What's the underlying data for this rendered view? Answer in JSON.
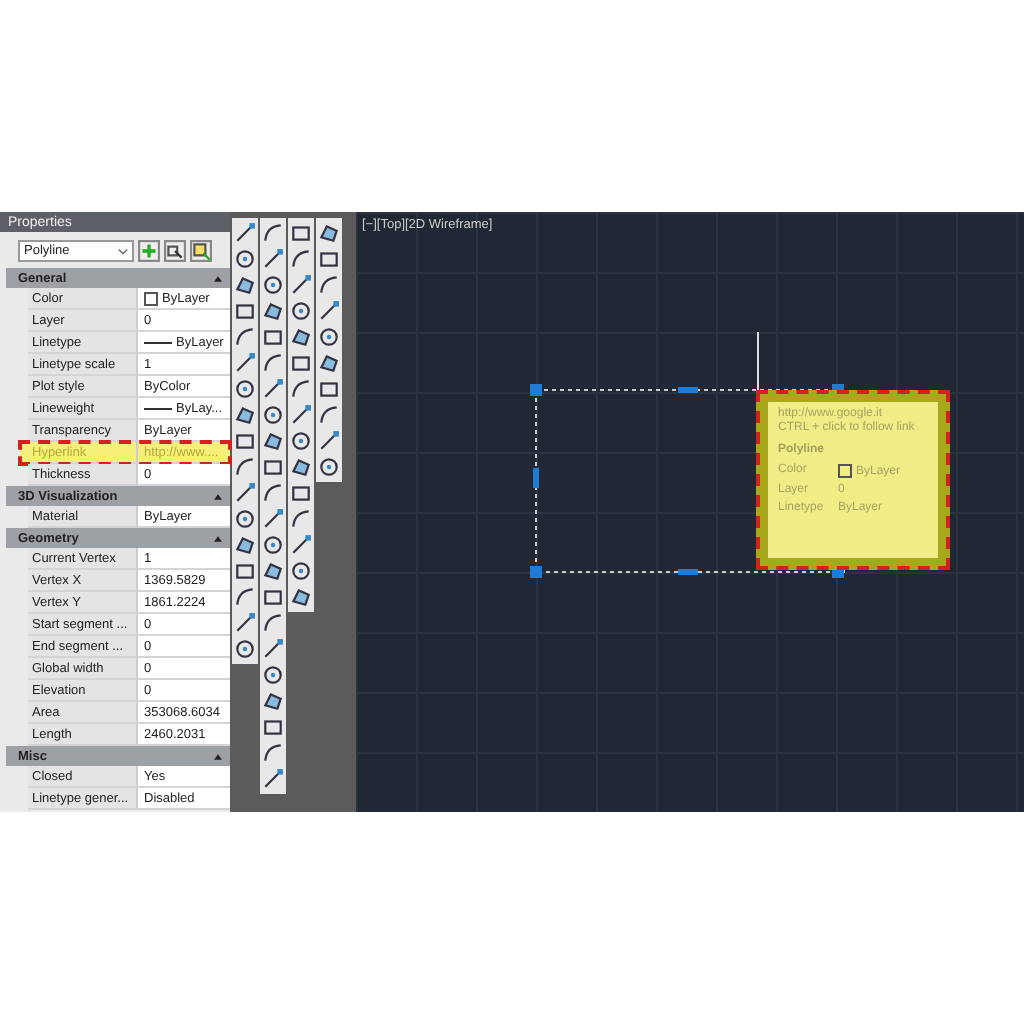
{
  "palette": {
    "title": "Properties",
    "object_type": "Polyline"
  },
  "sections": [
    {
      "title": "General",
      "expanded": true,
      "rows": [
        {
          "label": "Color",
          "value": "ByLayer",
          "kind": "swatch",
          "highlighted": false
        },
        {
          "label": "Layer",
          "value": "0",
          "kind": "text",
          "highlighted": false
        },
        {
          "label": "Linetype",
          "value": "ByLayer",
          "kind": "line",
          "highlighted": false
        },
        {
          "label": "Linetype scale",
          "value": "1",
          "kind": "text",
          "highlighted": false
        },
        {
          "label": "Plot style",
          "value": "ByColor",
          "kind": "text",
          "highlighted": false
        },
        {
          "label": "Lineweight",
          "value": "ByLay...",
          "kind": "line",
          "highlighted": false
        },
        {
          "label": "Transparency",
          "value": "ByLayer",
          "kind": "text",
          "highlighted": false
        },
        {
          "label": "Hyperlink",
          "value": "http://www....",
          "kind": "text",
          "highlighted": true
        },
        {
          "label": "Thickness",
          "value": "0",
          "kind": "text",
          "highlighted": false
        }
      ]
    },
    {
      "title": "3D Visualization",
      "expanded": true,
      "rows": [
        {
          "label": "Material",
          "value": "ByLayer",
          "kind": "text",
          "highlighted": false
        }
      ]
    },
    {
      "title": "Geometry",
      "expanded": true,
      "rows": [
        {
          "label": "Current Vertex",
          "value": "1",
          "kind": "text",
          "highlighted": false
        },
        {
          "label": "Vertex X",
          "value": "1369.5829",
          "kind": "text",
          "highlighted": false
        },
        {
          "label": "Vertex Y",
          "value": "1861.2224",
          "kind": "text",
          "highlighted": false
        },
        {
          "label": "Start segment ...",
          "value": "0",
          "kind": "text",
          "highlighted": false
        },
        {
          "label": "End segment ...",
          "value": "0",
          "kind": "text",
          "highlighted": false
        },
        {
          "label": "Global width",
          "value": "0",
          "kind": "text",
          "highlighted": false
        },
        {
          "label": "Elevation",
          "value": "0",
          "kind": "text",
          "highlighted": false
        },
        {
          "label": "Area",
          "value": "353068.6034",
          "kind": "text",
          "highlighted": false
        },
        {
          "label": "Length",
          "value": "2460.2031",
          "kind": "text",
          "highlighted": false
        }
      ]
    },
    {
      "title": "Misc",
      "expanded": true,
      "rows": [
        {
          "label": "Closed",
          "value": "Yes",
          "kind": "text",
          "highlighted": false
        },
        {
          "label": "Linetype gener...",
          "value": "Disabled",
          "kind": "text",
          "highlighted": false
        }
      ]
    }
  ],
  "viewport": {
    "label": "[−][Top][2D Wireframe]"
  },
  "tooltip": {
    "highlighted": true,
    "link": "http://www.google.it",
    "hint": "CTRL + click to follow link",
    "object": "Polyline",
    "rows": [
      {
        "label": "Color",
        "value": "ByLayer",
        "kind": "swatch"
      },
      {
        "label": "Layer",
        "value": "0",
        "kind": "text"
      },
      {
        "label": "Linetype",
        "value": "ByLayer",
        "kind": "text"
      }
    ]
  }
}
